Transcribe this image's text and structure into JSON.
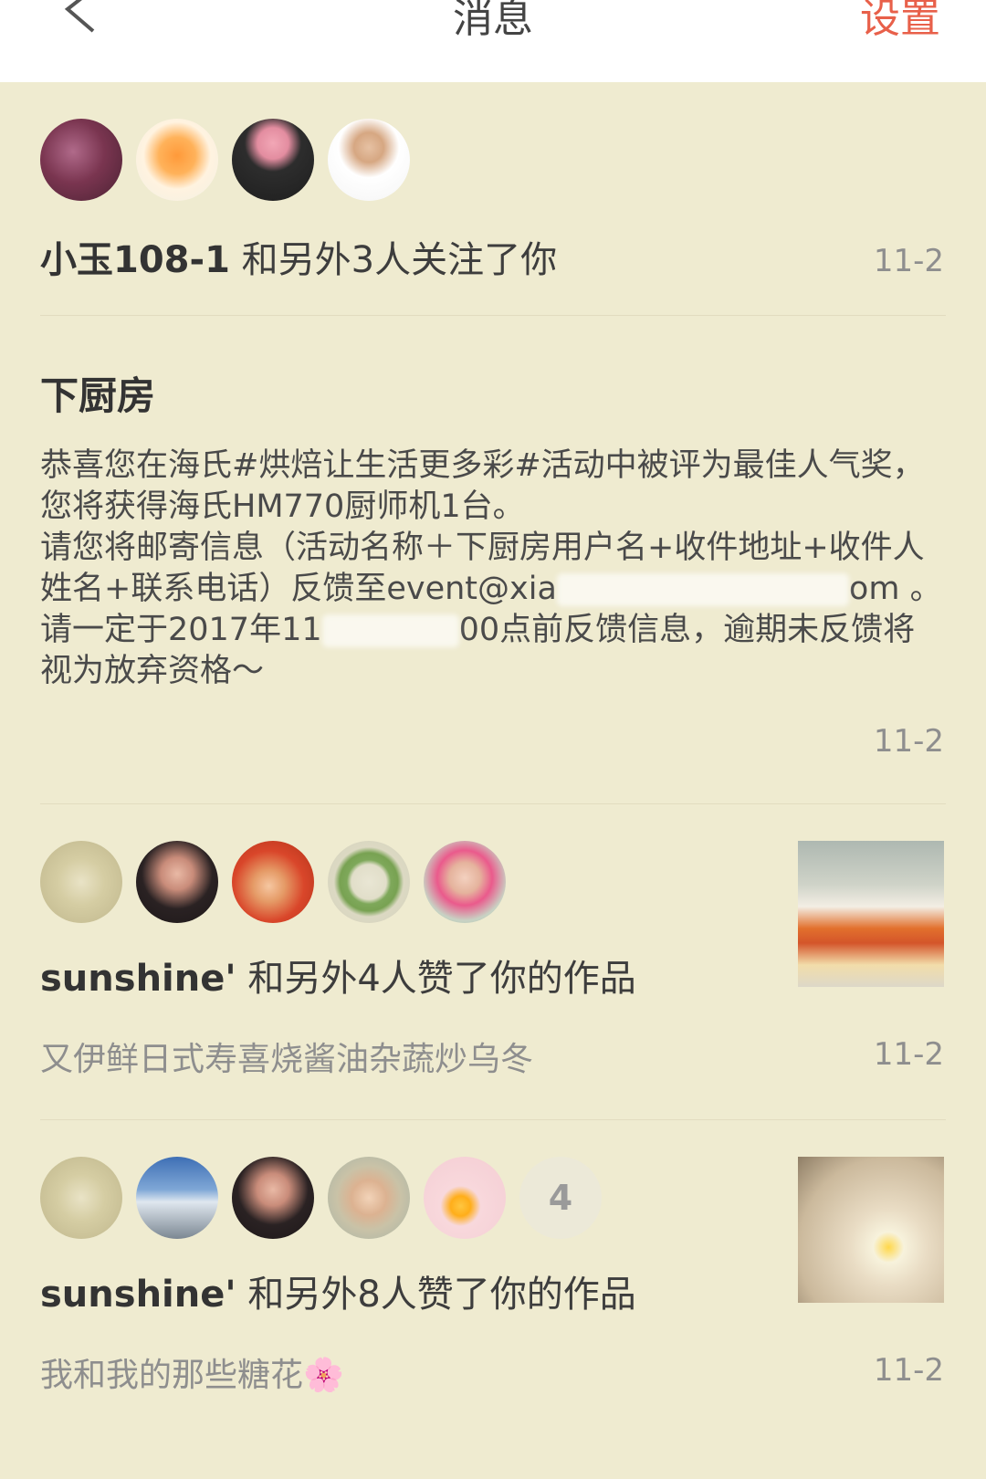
{
  "header": {
    "title": "消息",
    "settings_label": "设置"
  },
  "follow_card": {
    "user": "小玉108-1",
    "text": " 和另外3人关注了你",
    "date": "11-2"
  },
  "system_card": {
    "title": "下厨房",
    "body_line1": "恭喜您在海氏#烘焙让生活更多彩#活动中被评为最佳人气奖，您将获得海氏HM770厨师机1台。",
    "body_line2a": "请您将邮寄信息（活动名称＋下厨房用户名+收件地址+收件人姓名+联系电话）反馈至",
    "body_email_visible_start": "event@xia",
    "body_email_visible_end": "om",
    "body_line2b": "。请一定于2017年11",
    "body_line2c": "00点前反馈信息，逾期未反馈将视为放弃资格～",
    "date": "11-2"
  },
  "like_card_1": {
    "user": "sunshine'",
    "text": " 和另外4人赞了你的作品",
    "work_title": "又伊鲜日式寿喜烧酱油杂蔬炒乌冬",
    "date": "11-2"
  },
  "like_card_2": {
    "user": "sunshine'",
    "text": " 和另外8人赞了你的作品",
    "work_title": "我和我的那些糖花🌸",
    "more_count": "4",
    "date": "11-2"
  },
  "colors": {
    "background": "#efebd0",
    "accent": "#e8604a",
    "header_bg": "#ffffff"
  }
}
